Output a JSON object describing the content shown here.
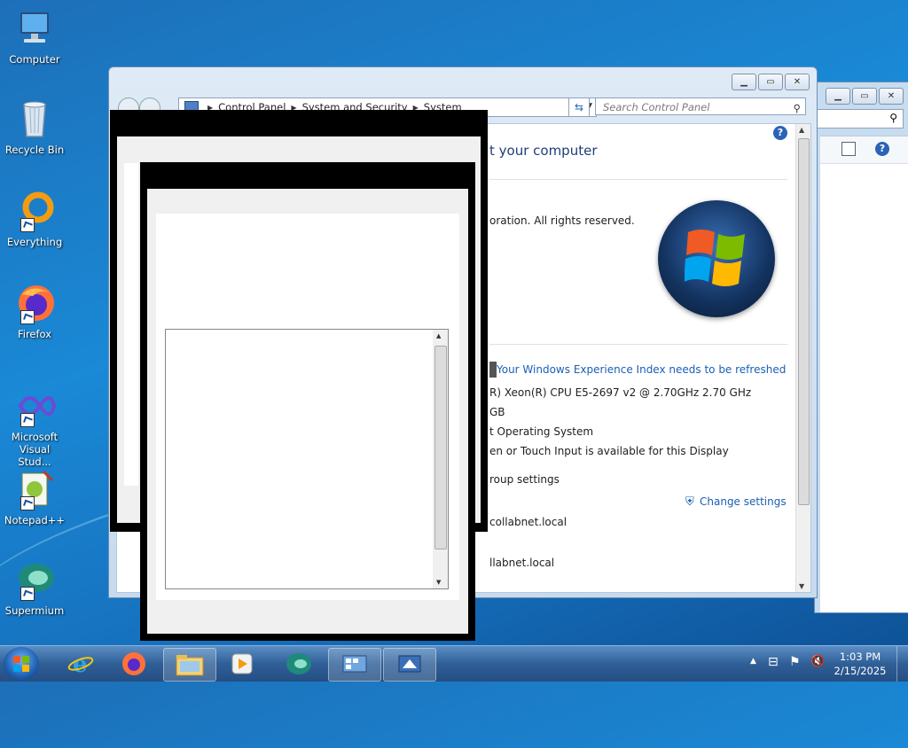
{
  "desktop": {
    "icons": [
      {
        "label": "Computer"
      },
      {
        "label": "Recycle Bin"
      },
      {
        "label": "Everything"
      },
      {
        "label": "Firefox"
      },
      {
        "label_line1": "Microsoft",
        "label_line2": "Visual Stud..."
      },
      {
        "label": "Notepad++"
      },
      {
        "label": "Supermium"
      }
    ]
  },
  "system_window": {
    "breadcrumb": [
      "Control Panel",
      "System and Security",
      "System"
    ],
    "search_placeholder": "Search Control Panel",
    "heading_fragment": "t your computer",
    "copyright_fragment": "oration.  All rights reserved.",
    "experience_link": "Your Windows Experience Index needs to be refreshed",
    "processor_fragment": "R) Xeon(R) CPU E5-2697 v2 @ 2.70GHz   2.70 GHz",
    "memory_fragment": "GB",
    "system_type_fragment": "t Operating System",
    "pen_touch_fragment": "en or Touch Input is available for this Display",
    "group_settings_fragment": "roup settings",
    "change_settings": "Change settings",
    "full_name_fragment": "collabnet.local",
    "domain_fragment": "llabnet.local"
  },
  "taskbar": {
    "clock_time": "1:03 PM",
    "clock_date": "2/15/2025"
  }
}
